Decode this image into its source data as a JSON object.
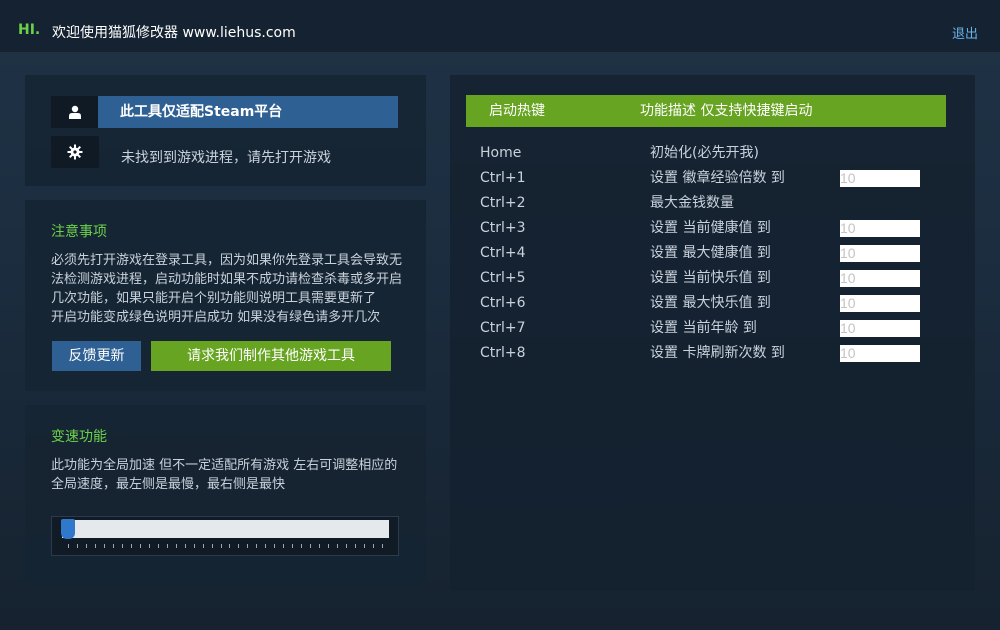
{
  "app": {
    "hi": "HI.",
    "title": "欢迎使用猫狐修改器 www.liehus.com",
    "logout": "退出"
  },
  "status": {
    "platform_label": "此工具仅适配Steam平台",
    "process_status": "未找到到游戏进程，请先打开游戏",
    "icons": [
      "user-icon",
      "gear-icon"
    ]
  },
  "notes": {
    "title": "注意事项",
    "lines": [
      "必须先打开游戏在登录工具，因为如果你先登录工具会导致无",
      "法检测游戏进程，启动功能时如果不成功请检查杀毒或多开启",
      "几次功能，如果只能开启个别功能则说明工具需要更新了",
      "开启功能变成绿色说明开启成功 如果没有绿色请多开几次"
    ],
    "feedback_button": "反馈更新",
    "request_button": "请求我们制作其他游戏工具"
  },
  "speed": {
    "title": "变速功能",
    "lines": [
      "此功能为全局加速 但不一定适配所有游戏 左右可调整相应的",
      "全局速度，最左侧是最慢，最右侧是最快"
    ],
    "slider_value_fraction": 0.0
  },
  "hotkeys": {
    "header_key": "启动热键",
    "header_desc": "功能描述 仅支持快捷键启动",
    "rows": [
      {
        "key": "Home",
        "desc": "初始化(必先开我)",
        "input": null
      },
      {
        "key": "Ctrl+1",
        "desc": "设置 徽章经验倍数 到",
        "input": "10"
      },
      {
        "key": "Ctrl+2",
        "desc": "最大金钱数量",
        "input": null
      },
      {
        "key": "Ctrl+3",
        "desc": "设置 当前健康值 到",
        "input": "10"
      },
      {
        "key": "Ctrl+4",
        "desc": "设置 最大健康值 到",
        "input": "10"
      },
      {
        "key": "Ctrl+5",
        "desc": "设置 当前快乐值 到",
        "input": "10"
      },
      {
        "key": "Ctrl+6",
        "desc": "设置 最大快乐值 到",
        "input": "10"
      },
      {
        "key": "Ctrl+7",
        "desc": "设置 当前年龄 到",
        "input": "10"
      },
      {
        "key": "Ctrl+8",
        "desc": "设置 卡牌刷新次数 到",
        "input": "10"
      }
    ]
  },
  "colors": {
    "accent_green": "#67a422",
    "text_green": "#6cd14a",
    "accent_blue": "#2e6093",
    "link_blue": "#6ab1e6"
  }
}
